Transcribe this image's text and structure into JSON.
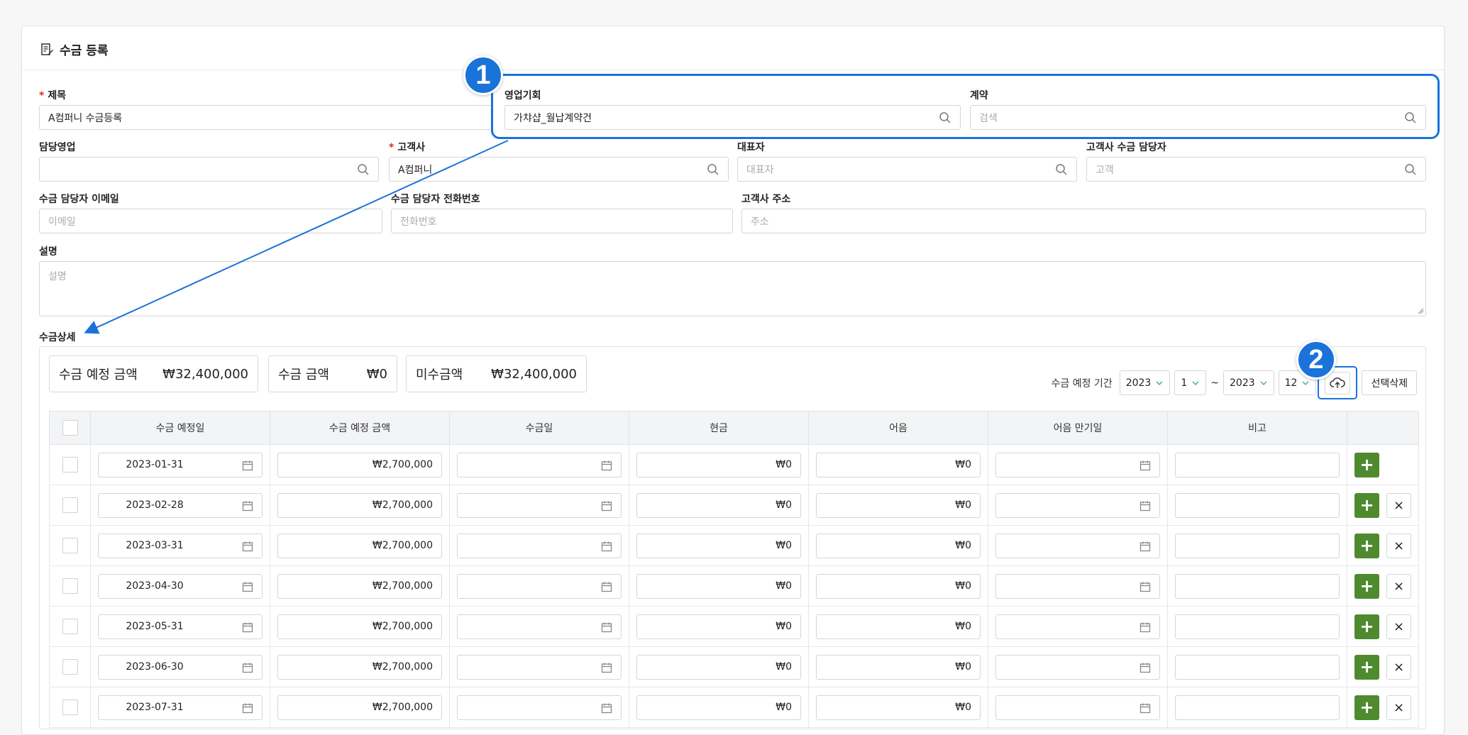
{
  "header": {
    "title": "수금 등록"
  },
  "form": {
    "title": {
      "label": "제목",
      "value": "A컴퍼니 수금등록"
    },
    "opportunity": {
      "label": "영업기회",
      "value": "가챠샵_월납계약건"
    },
    "contract": {
      "label": "계약",
      "placeholder": "검색"
    },
    "sales_rep": {
      "label": "담당영업",
      "value": ""
    },
    "customer": {
      "label": "고객사",
      "value": "A컴퍼니"
    },
    "representative": {
      "label": "대표자",
      "placeholder": "대표자"
    },
    "customer_contact": {
      "label": "고객사 수금 담당자",
      "placeholder": "고객"
    },
    "contact_email": {
      "label": "수금 담당자 이메일",
      "placeholder": "이메일"
    },
    "contact_phone": {
      "label": "수금 담당자 전화번호",
      "placeholder": "전화번호"
    },
    "customer_address": {
      "label": "고객사 주소",
      "placeholder": "주소"
    },
    "description": {
      "label": "설명",
      "placeholder": "설명"
    }
  },
  "detail": {
    "section_label": "수금상세",
    "summary": [
      {
        "label": "수금 예정 금액",
        "amount": "₩32,400,000"
      },
      {
        "label": "수금 금액",
        "amount": "₩0"
      },
      {
        "label": "미수금액",
        "amount": "₩32,400,000"
      }
    ],
    "period": {
      "label": "수금 예정 기간",
      "from_year": "2023",
      "from_month": "1",
      "separator": "~",
      "to_year": "2023",
      "to_month": "12"
    },
    "delete_selected_label": "선택삭제",
    "columns": [
      "수금 예정일",
      "수금 예정 금액",
      "수금일",
      "현금",
      "어음",
      "어음 만기일",
      "비고"
    ],
    "rows": [
      {
        "due_date": "2023-01-31",
        "due_amount": "₩2,700,000",
        "cash": "₩0",
        "bill": "₩0"
      },
      {
        "due_date": "2023-02-28",
        "due_amount": "₩2,700,000",
        "cash": "₩0",
        "bill": "₩0"
      },
      {
        "due_date": "2023-03-31",
        "due_amount": "₩2,700,000",
        "cash": "₩0",
        "bill": "₩0"
      },
      {
        "due_date": "2023-04-30",
        "due_amount": "₩2,700,000",
        "cash": "₩0",
        "bill": "₩0"
      },
      {
        "due_date": "2023-05-31",
        "due_amount": "₩2,700,000",
        "cash": "₩0",
        "bill": "₩0"
      },
      {
        "due_date": "2023-06-30",
        "due_amount": "₩2,700,000",
        "cash": "₩0",
        "bill": "₩0"
      },
      {
        "due_date": "2023-07-31",
        "due_amount": "₩2,700,000",
        "cash": "₩0",
        "bill": "₩0"
      }
    ],
    "add_row_symbol": "+",
    "remove_row_symbol": "×"
  },
  "annotations": {
    "badge_1": "1",
    "badge_2": "2"
  },
  "colors": {
    "highlight": "#1a73d9",
    "add_button": "#4f8a2f",
    "required": "#d32f2f"
  }
}
